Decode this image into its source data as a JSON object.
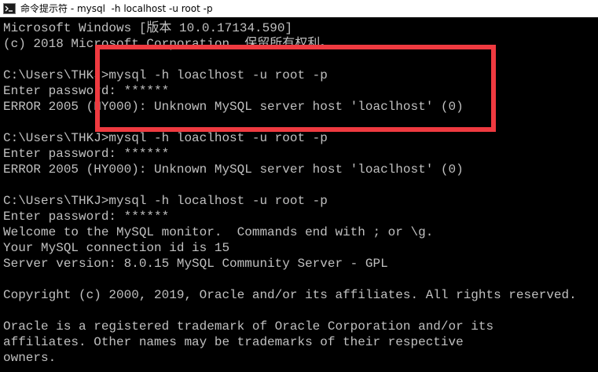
{
  "window": {
    "title": "命令提示符 - mysql  -h localhost -u root -p"
  },
  "console": {
    "lines": [
      "Microsoft Windows [版本 10.0.17134.590]",
      "(c) 2018 Microsoft Corporation. 保留所有权利。",
      "",
      "C:\\Users\\THKJ>mysql -h loaclhost -u root -p",
      "Enter password: ******",
      "ERROR 2005 (HY000): Unknown MySQL server host 'loaclhost' (0)",
      "",
      "C:\\Users\\THKJ>mysql -h loaclhost -u root -p",
      "Enter password: ******",
      "ERROR 2005 (HY000): Unknown MySQL server host 'loaclhost' (0)",
      "",
      "C:\\Users\\THKJ>mysql -h localhost -u root -p",
      "Enter password: ******",
      "Welcome to the MySQL monitor.  Commands end with ; or \\g.",
      "Your MySQL connection id is 15",
      "Server version: 8.0.15 MySQL Community Server - GPL",
      "",
      "Copyright (c) 2000, 2019, Oracle and/or its affiliates. All rights reserved.",
      "",
      "Oracle is a registered trademark of Oracle Corporation and/or its",
      "affiliates. Other names may be trademarks of their respective",
      "owners."
    ]
  },
  "colors": {
    "console_background": "#000000",
    "console_text": "#c0c0c0",
    "titlebar_background": "#ffffff",
    "highlight_border": "#ef3a40"
  },
  "icons": {
    "title_icon": "command-prompt-icon"
  }
}
